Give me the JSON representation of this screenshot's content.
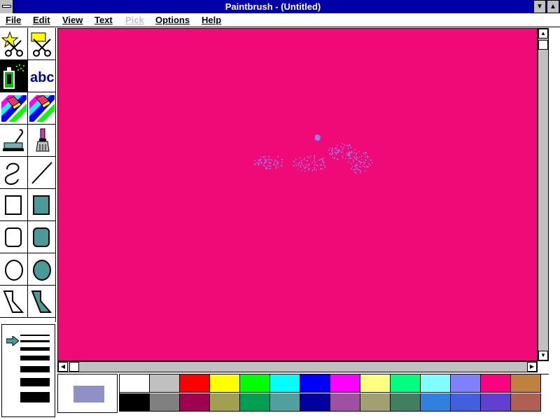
{
  "window": {
    "title": "Paintbrush - (Untitled)",
    "minimize_glyph": "▼",
    "maximize_glyph": "▲"
  },
  "menubar": {
    "items": [
      {
        "label": "File",
        "enabled": true
      },
      {
        "label": "Edit",
        "enabled": true
      },
      {
        "label": "View",
        "enabled": true
      },
      {
        "label": "Text",
        "enabled": true
      },
      {
        "label": "Pick",
        "enabled": false
      },
      {
        "label": "Options",
        "enabled": true
      },
      {
        "label": "Help",
        "enabled": true
      }
    ]
  },
  "toolbox": {
    "tools": [
      {
        "name": "scissors-tool",
        "icon": "scissors-star-icon",
        "selected": false
      },
      {
        "name": "pick-tool",
        "icon": "scissors-rect-icon",
        "selected": false
      },
      {
        "name": "airbrush-tool",
        "icon": "airbrush-icon",
        "selected": true
      },
      {
        "name": "text-tool",
        "icon": "text-icon",
        "selected": false,
        "label": "abc"
      },
      {
        "name": "color-eraser-tool",
        "icon": "color-eraser-icon",
        "selected": false
      },
      {
        "name": "eraser-tool",
        "icon": "eraser-icon",
        "selected": false
      },
      {
        "name": "paint-roller-tool",
        "icon": "paint-roller-icon",
        "selected": false
      },
      {
        "name": "brush-tool",
        "icon": "brush-icon",
        "selected": false
      },
      {
        "name": "curve-tool",
        "icon": "curve-icon",
        "selected": false
      },
      {
        "name": "line-tool",
        "icon": "line-icon",
        "selected": false
      },
      {
        "name": "box-tool",
        "icon": "box-outline-icon",
        "selected": false
      },
      {
        "name": "filled-box-tool",
        "icon": "box-filled-icon",
        "selected": false
      },
      {
        "name": "rounded-box-tool",
        "icon": "rounded-box-outline-icon",
        "selected": false
      },
      {
        "name": "filled-rounded-box-tool",
        "icon": "rounded-box-filled-icon",
        "selected": false
      },
      {
        "name": "circle-tool",
        "icon": "circle-outline-icon",
        "selected": false
      },
      {
        "name": "filled-circle-tool",
        "icon": "circle-filled-icon",
        "selected": false
      },
      {
        "name": "polygon-tool",
        "icon": "polygon-outline-icon",
        "selected": false
      },
      {
        "name": "filled-polygon-tool",
        "icon": "polygon-filled-icon",
        "selected": false
      }
    ]
  },
  "linesize": {
    "selected_index": 0,
    "widths": [
      2,
      3,
      5,
      7,
      9,
      11,
      14
    ]
  },
  "canvas": {
    "background_color": "#f00a78",
    "spray_color": "#8888ee"
  },
  "palette": {
    "foreground_color": "#9090c8",
    "background_color": "#ffffff",
    "top_row": [
      "#ffffff",
      "#c0c0c0",
      "#ff0000",
      "#ffff00",
      "#00ff00",
      "#00ffff",
      "#0000ff",
      "#ff00ff",
      "#ffff80",
      "#00ff80",
      "#80ffff",
      "#8080ff",
      "#ff0080",
      "#c08040"
    ],
    "bottom_row": [
      "#000000",
      "#808080",
      "#a00050",
      "#a0a050",
      "#00a050",
      "#50a0a0",
      "#0000a0",
      "#a050a0",
      "#a0a070",
      "#408060",
      "#3080e0",
      "#4060e0",
      "#6040d0",
      "#b06050"
    ]
  }
}
